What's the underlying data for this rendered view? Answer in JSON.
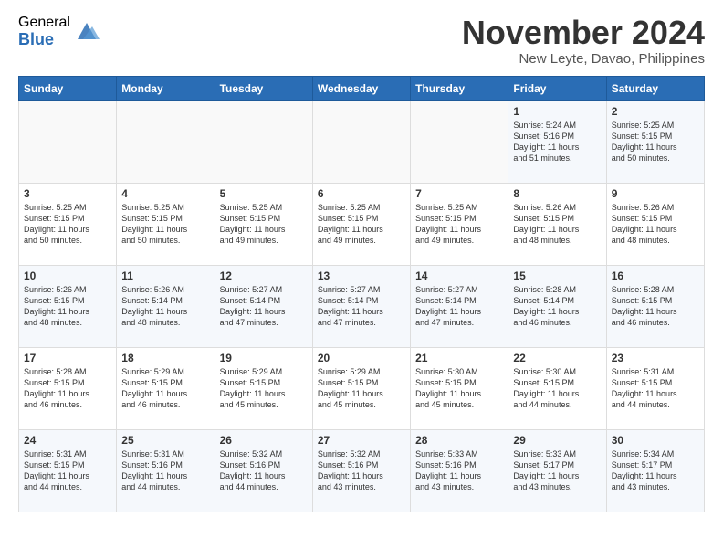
{
  "header": {
    "logo_general": "General",
    "logo_blue": "Blue",
    "month_title": "November 2024",
    "location": "New Leyte, Davao, Philippines"
  },
  "days_of_week": [
    "Sunday",
    "Monday",
    "Tuesday",
    "Wednesday",
    "Thursday",
    "Friday",
    "Saturday"
  ],
  "weeks": [
    [
      {
        "day": "",
        "info": ""
      },
      {
        "day": "",
        "info": ""
      },
      {
        "day": "",
        "info": ""
      },
      {
        "day": "",
        "info": ""
      },
      {
        "day": "",
        "info": ""
      },
      {
        "day": "1",
        "info": "Sunrise: 5:24 AM\nSunset: 5:16 PM\nDaylight: 11 hours\nand 51 minutes."
      },
      {
        "day": "2",
        "info": "Sunrise: 5:25 AM\nSunset: 5:15 PM\nDaylight: 11 hours\nand 50 minutes."
      }
    ],
    [
      {
        "day": "3",
        "info": "Sunrise: 5:25 AM\nSunset: 5:15 PM\nDaylight: 11 hours\nand 50 minutes."
      },
      {
        "day": "4",
        "info": "Sunrise: 5:25 AM\nSunset: 5:15 PM\nDaylight: 11 hours\nand 50 minutes."
      },
      {
        "day": "5",
        "info": "Sunrise: 5:25 AM\nSunset: 5:15 PM\nDaylight: 11 hours\nand 49 minutes."
      },
      {
        "day": "6",
        "info": "Sunrise: 5:25 AM\nSunset: 5:15 PM\nDaylight: 11 hours\nand 49 minutes."
      },
      {
        "day": "7",
        "info": "Sunrise: 5:25 AM\nSunset: 5:15 PM\nDaylight: 11 hours\nand 49 minutes."
      },
      {
        "day": "8",
        "info": "Sunrise: 5:26 AM\nSunset: 5:15 PM\nDaylight: 11 hours\nand 48 minutes."
      },
      {
        "day": "9",
        "info": "Sunrise: 5:26 AM\nSunset: 5:15 PM\nDaylight: 11 hours\nand 48 minutes."
      }
    ],
    [
      {
        "day": "10",
        "info": "Sunrise: 5:26 AM\nSunset: 5:15 PM\nDaylight: 11 hours\nand 48 minutes."
      },
      {
        "day": "11",
        "info": "Sunrise: 5:26 AM\nSunset: 5:14 PM\nDaylight: 11 hours\nand 48 minutes."
      },
      {
        "day": "12",
        "info": "Sunrise: 5:27 AM\nSunset: 5:14 PM\nDaylight: 11 hours\nand 47 minutes."
      },
      {
        "day": "13",
        "info": "Sunrise: 5:27 AM\nSunset: 5:14 PM\nDaylight: 11 hours\nand 47 minutes."
      },
      {
        "day": "14",
        "info": "Sunrise: 5:27 AM\nSunset: 5:14 PM\nDaylight: 11 hours\nand 47 minutes."
      },
      {
        "day": "15",
        "info": "Sunrise: 5:28 AM\nSunset: 5:14 PM\nDaylight: 11 hours\nand 46 minutes."
      },
      {
        "day": "16",
        "info": "Sunrise: 5:28 AM\nSunset: 5:15 PM\nDaylight: 11 hours\nand 46 minutes."
      }
    ],
    [
      {
        "day": "17",
        "info": "Sunrise: 5:28 AM\nSunset: 5:15 PM\nDaylight: 11 hours\nand 46 minutes."
      },
      {
        "day": "18",
        "info": "Sunrise: 5:29 AM\nSunset: 5:15 PM\nDaylight: 11 hours\nand 46 minutes."
      },
      {
        "day": "19",
        "info": "Sunrise: 5:29 AM\nSunset: 5:15 PM\nDaylight: 11 hours\nand 45 minutes."
      },
      {
        "day": "20",
        "info": "Sunrise: 5:29 AM\nSunset: 5:15 PM\nDaylight: 11 hours\nand 45 minutes."
      },
      {
        "day": "21",
        "info": "Sunrise: 5:30 AM\nSunset: 5:15 PM\nDaylight: 11 hours\nand 45 minutes."
      },
      {
        "day": "22",
        "info": "Sunrise: 5:30 AM\nSunset: 5:15 PM\nDaylight: 11 hours\nand 44 minutes."
      },
      {
        "day": "23",
        "info": "Sunrise: 5:31 AM\nSunset: 5:15 PM\nDaylight: 11 hours\nand 44 minutes."
      }
    ],
    [
      {
        "day": "24",
        "info": "Sunrise: 5:31 AM\nSunset: 5:15 PM\nDaylight: 11 hours\nand 44 minutes."
      },
      {
        "day": "25",
        "info": "Sunrise: 5:31 AM\nSunset: 5:16 PM\nDaylight: 11 hours\nand 44 minutes."
      },
      {
        "day": "26",
        "info": "Sunrise: 5:32 AM\nSunset: 5:16 PM\nDaylight: 11 hours\nand 44 minutes."
      },
      {
        "day": "27",
        "info": "Sunrise: 5:32 AM\nSunset: 5:16 PM\nDaylight: 11 hours\nand 43 minutes."
      },
      {
        "day": "28",
        "info": "Sunrise: 5:33 AM\nSunset: 5:16 PM\nDaylight: 11 hours\nand 43 minutes."
      },
      {
        "day": "29",
        "info": "Sunrise: 5:33 AM\nSunset: 5:17 PM\nDaylight: 11 hours\nand 43 minutes."
      },
      {
        "day": "30",
        "info": "Sunrise: 5:34 AM\nSunset: 5:17 PM\nDaylight: 11 hours\nand 43 minutes."
      }
    ]
  ]
}
